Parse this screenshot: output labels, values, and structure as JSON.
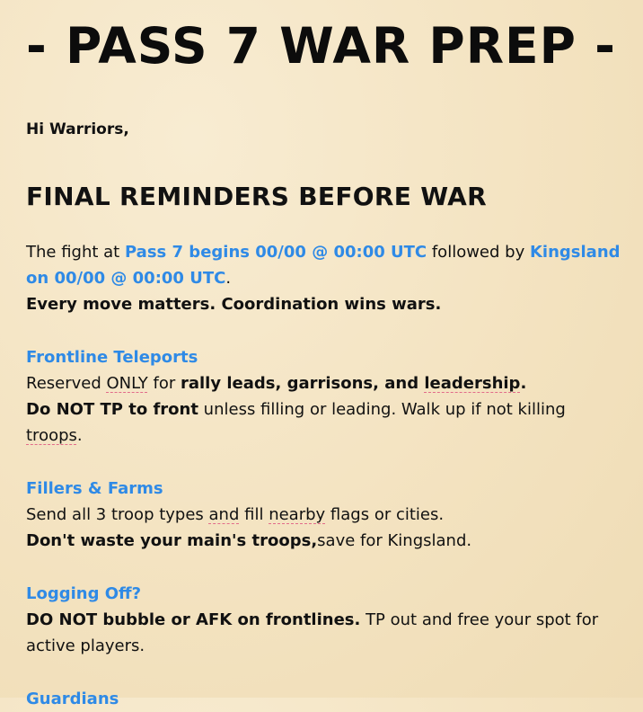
{
  "title": "- PASS 7 WAR PREP -",
  "greeting": "Hi Warriors,",
  "heading": "FINAL REMINDERS BEFORE WAR",
  "intro": {
    "t1": "The fight at ",
    "b1": "Pass 7 begins 00/00 @ 00:00 UTC",
    "t2": " followed by ",
    "b2": "Kingsland on 00/00 @ 00:00 UTC",
    "t3": ".",
    "line2": "Every move matters. Coordination wins wars."
  },
  "frontline": {
    "heading": "Frontline Teleports",
    "l1_a": "Reserved ",
    "l1_b": "ONLY",
    "l1_c": " for ",
    "l1_d1": "rally leads",
    "l1_d2": ", garrisons, and ",
    "l1_d3": "leadership",
    "l1_d4": ".",
    "l2_bold": "Do NOT TP to front",
    "l2_rest": " unless filling or leading. Walk up if not killing ",
    "l2_end": "troops",
    "l2_dot": "."
  },
  "fillers": {
    "heading": "Fillers & Farms",
    "l1_a": "Send all 3 troop types ",
    "l1_b": "and",
    "l1_c": " fill ",
    "l1_d": "nearby",
    "l1_e": " flags or cities.",
    "l2_bold": "Don't waste your main's troops,",
    "l2_rest": "save for Kingsland."
  },
  "logging": {
    "heading": "Logging Off?",
    "l1_bold": "DO NOT bubble or AFK on frontlines.",
    "l1_rest": " TP out and free your spot for active players."
  },
  "guardians": {
    "heading": "Guardians"
  }
}
